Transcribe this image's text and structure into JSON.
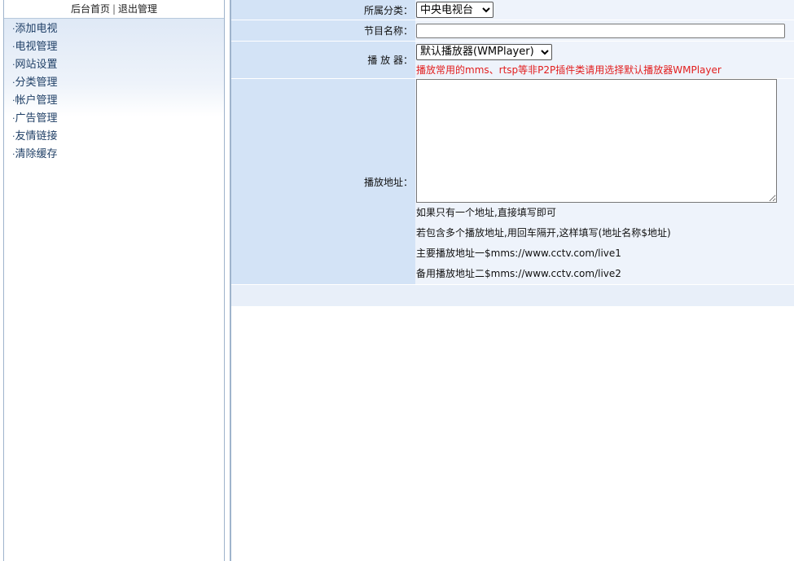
{
  "header": {
    "home_link": "后台首页",
    "separator": "|",
    "logout_link": "退出管理"
  },
  "menu": {
    "items": [
      {
        "dot": "·",
        "label": "添加电视"
      },
      {
        "dot": "·",
        "label": "电视管理"
      },
      {
        "dot": "·",
        "label": "网站设置"
      },
      {
        "dot": "·",
        "label": "分类管理"
      },
      {
        "dot": "·",
        "label": "帐户管理"
      },
      {
        "dot": "·",
        "label": "广告管理"
      },
      {
        "dot": "·",
        "label": "友情链接"
      },
      {
        "dot": "·",
        "label": "清除缓存"
      }
    ]
  },
  "form": {
    "category": {
      "label": "所属分类：",
      "selected": "中央电视台"
    },
    "program_name": {
      "label": "节目名称：",
      "value": ""
    },
    "player": {
      "label": "播 放 器：",
      "selected": "默认播放器(WMPlayer)",
      "hint": "播放常用的mms、rtsp等非P2P插件类请用选择默认播放器WMPlayer"
    },
    "play_url": {
      "label": "播放地址：",
      "value": "",
      "notes": [
        "如果只有一个地址,直接填写即可",
        "若包含多个播放地址,用回车隔开,这样填写(地址名称$地址)",
        "主要播放地址一$mms://www.cctv.com/live1",
        "备用播放地址二$mms://www.cctv.com/live2"
      ]
    }
  },
  "colors": {
    "label_bg": "#d3e3f6",
    "value_bg": "#eef3fb",
    "hint_red": "#e21d1d",
    "menu_text": "#1f3f66"
  }
}
